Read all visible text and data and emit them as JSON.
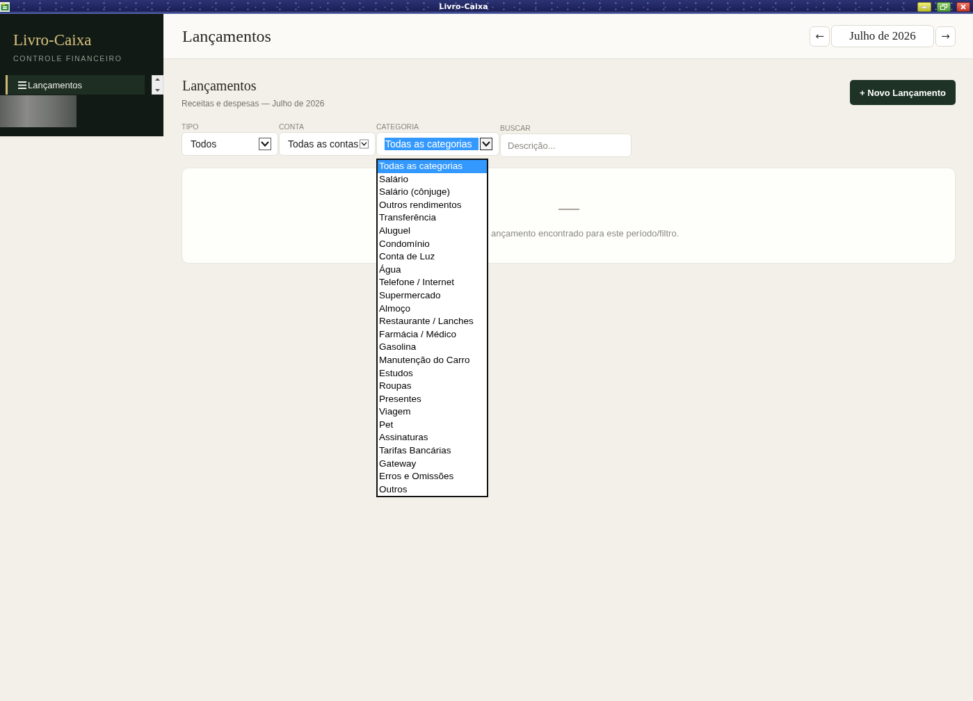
{
  "window": {
    "title": "Livro-Caixa"
  },
  "sidebar": {
    "brand": "Livro-Caixa",
    "tagline": "CONTROLE FINANCEIRO",
    "nav": [
      {
        "label": "Lançamentos",
        "selected": true
      }
    ]
  },
  "header": {
    "title": "Lançamentos",
    "prev": "←",
    "month": "Julho de 2026",
    "next": "→"
  },
  "section": {
    "title": "Lançamentos",
    "subtitle": "Receitas e despesas — Julho de 2026",
    "button": "+ Novo Lançamento"
  },
  "filters": [
    {
      "kind": "select",
      "label": "TIPO",
      "value": "Todos",
      "focused": false,
      "expanded": false
    },
    {
      "kind": "select",
      "label": "CONTA",
      "value": "Todas as contas",
      "focused": false,
      "expanded": false
    },
    {
      "kind": "select",
      "label": "CATEGORIA",
      "value": "Todas as categorias",
      "focused": true,
      "expanded": true,
      "options": [
        {
          "label": "Todas as categorias",
          "selected": true
        },
        {
          "label": "Salário",
          "selected": false
        },
        {
          "label": "Salário (cônjuge)",
          "selected": false
        },
        {
          "label": "Outros rendimentos",
          "selected": false
        },
        {
          "label": "Transferência",
          "selected": false
        },
        {
          "label": "Aluguel",
          "selected": false
        },
        {
          "label": "Condomínio",
          "selected": false
        },
        {
          "label": "Conta de Luz",
          "selected": false
        },
        {
          "label": "Água",
          "selected": false
        },
        {
          "label": "Telefone / Internet",
          "selected": false
        },
        {
          "label": "Supermercado",
          "selected": false
        },
        {
          "label": "Almoço",
          "selected": false
        },
        {
          "label": "Restaurante / Lanches",
          "selected": false
        },
        {
          "label": "Farmácia / Médico",
          "selected": false
        },
        {
          "label": "Gasolina",
          "selected": false
        },
        {
          "label": "Manutenção do Carro",
          "selected": false
        },
        {
          "label": "Estudos",
          "selected": false
        },
        {
          "label": "Roupas",
          "selected": false
        },
        {
          "label": "Presentes",
          "selected": false
        },
        {
          "label": "Viagem",
          "selected": false
        },
        {
          "label": "Pet",
          "selected": false
        },
        {
          "label": "Assinaturas",
          "selected": false
        },
        {
          "label": "Tarifas Bancárias",
          "selected": false
        },
        {
          "label": "Gateway",
          "selected": false
        },
        {
          "label": "Erros e Omissões",
          "selected": false
        },
        {
          "label": "Outros",
          "selected": false
        }
      ]
    },
    {
      "kind": "search",
      "label": "BUSCAR",
      "placeholder": "Descrição..."
    }
  ],
  "empty_state": {
    "message": "ançamento encontrado para este período/filtro."
  }
}
